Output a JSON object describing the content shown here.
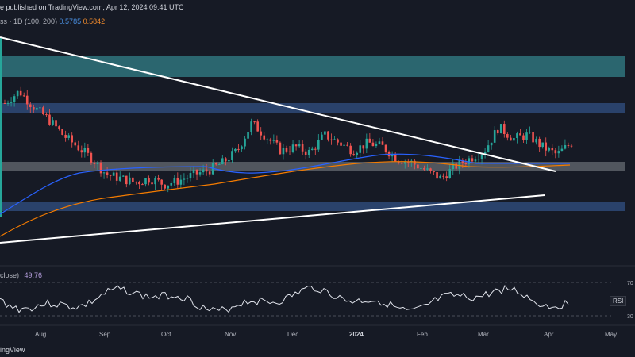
{
  "header": {
    "published": "e published on TradingView.com, Apr 12, 2024 09:41 UTC",
    "indicator_prefix": "ss · 1D (100, 200)",
    "ma1_value": "0.5785",
    "ma2_value": "0.5842"
  },
  "rsi": {
    "label": "close)",
    "value": "49.76",
    "tag": "RSI",
    "tag_value": "49",
    "levels": [
      "70",
      "30"
    ]
  },
  "brand": "ingView",
  "colors": {
    "background": "#161a25",
    "up": "#26a69a",
    "down": "#ef5350",
    "ma100": "#2962ff",
    "ma200": "#f57c00",
    "zone_teal": "#2e6f78",
    "zone_blue": "#2e4a78",
    "zone_grey": "#7a7e86",
    "rsi_line": "#e0e3eb"
  },
  "chart_data": {
    "type": "candlestick",
    "x_labels": [
      "Aug",
      "Sep",
      "Oct",
      "Nov",
      "Dec",
      "2024",
      "Feb",
      "Mar",
      "Apr",
      "May"
    ],
    "close_path": [
      0.72,
      0.78,
      0.7,
      0.64,
      0.56,
      0.5,
      0.44,
      0.36,
      0.34,
      0.32,
      0.34,
      0.31,
      0.33,
      0.36,
      0.38,
      0.42,
      0.48,
      0.62,
      0.55,
      0.48,
      0.5,
      0.47,
      0.56,
      0.52,
      0.48,
      0.52,
      0.5,
      0.44,
      0.42,
      0.38,
      0.34,
      0.4,
      0.44,
      0.48,
      0.6,
      0.54,
      0.56,
      0.5,
      0.46,
      0.52
    ]
  }
}
